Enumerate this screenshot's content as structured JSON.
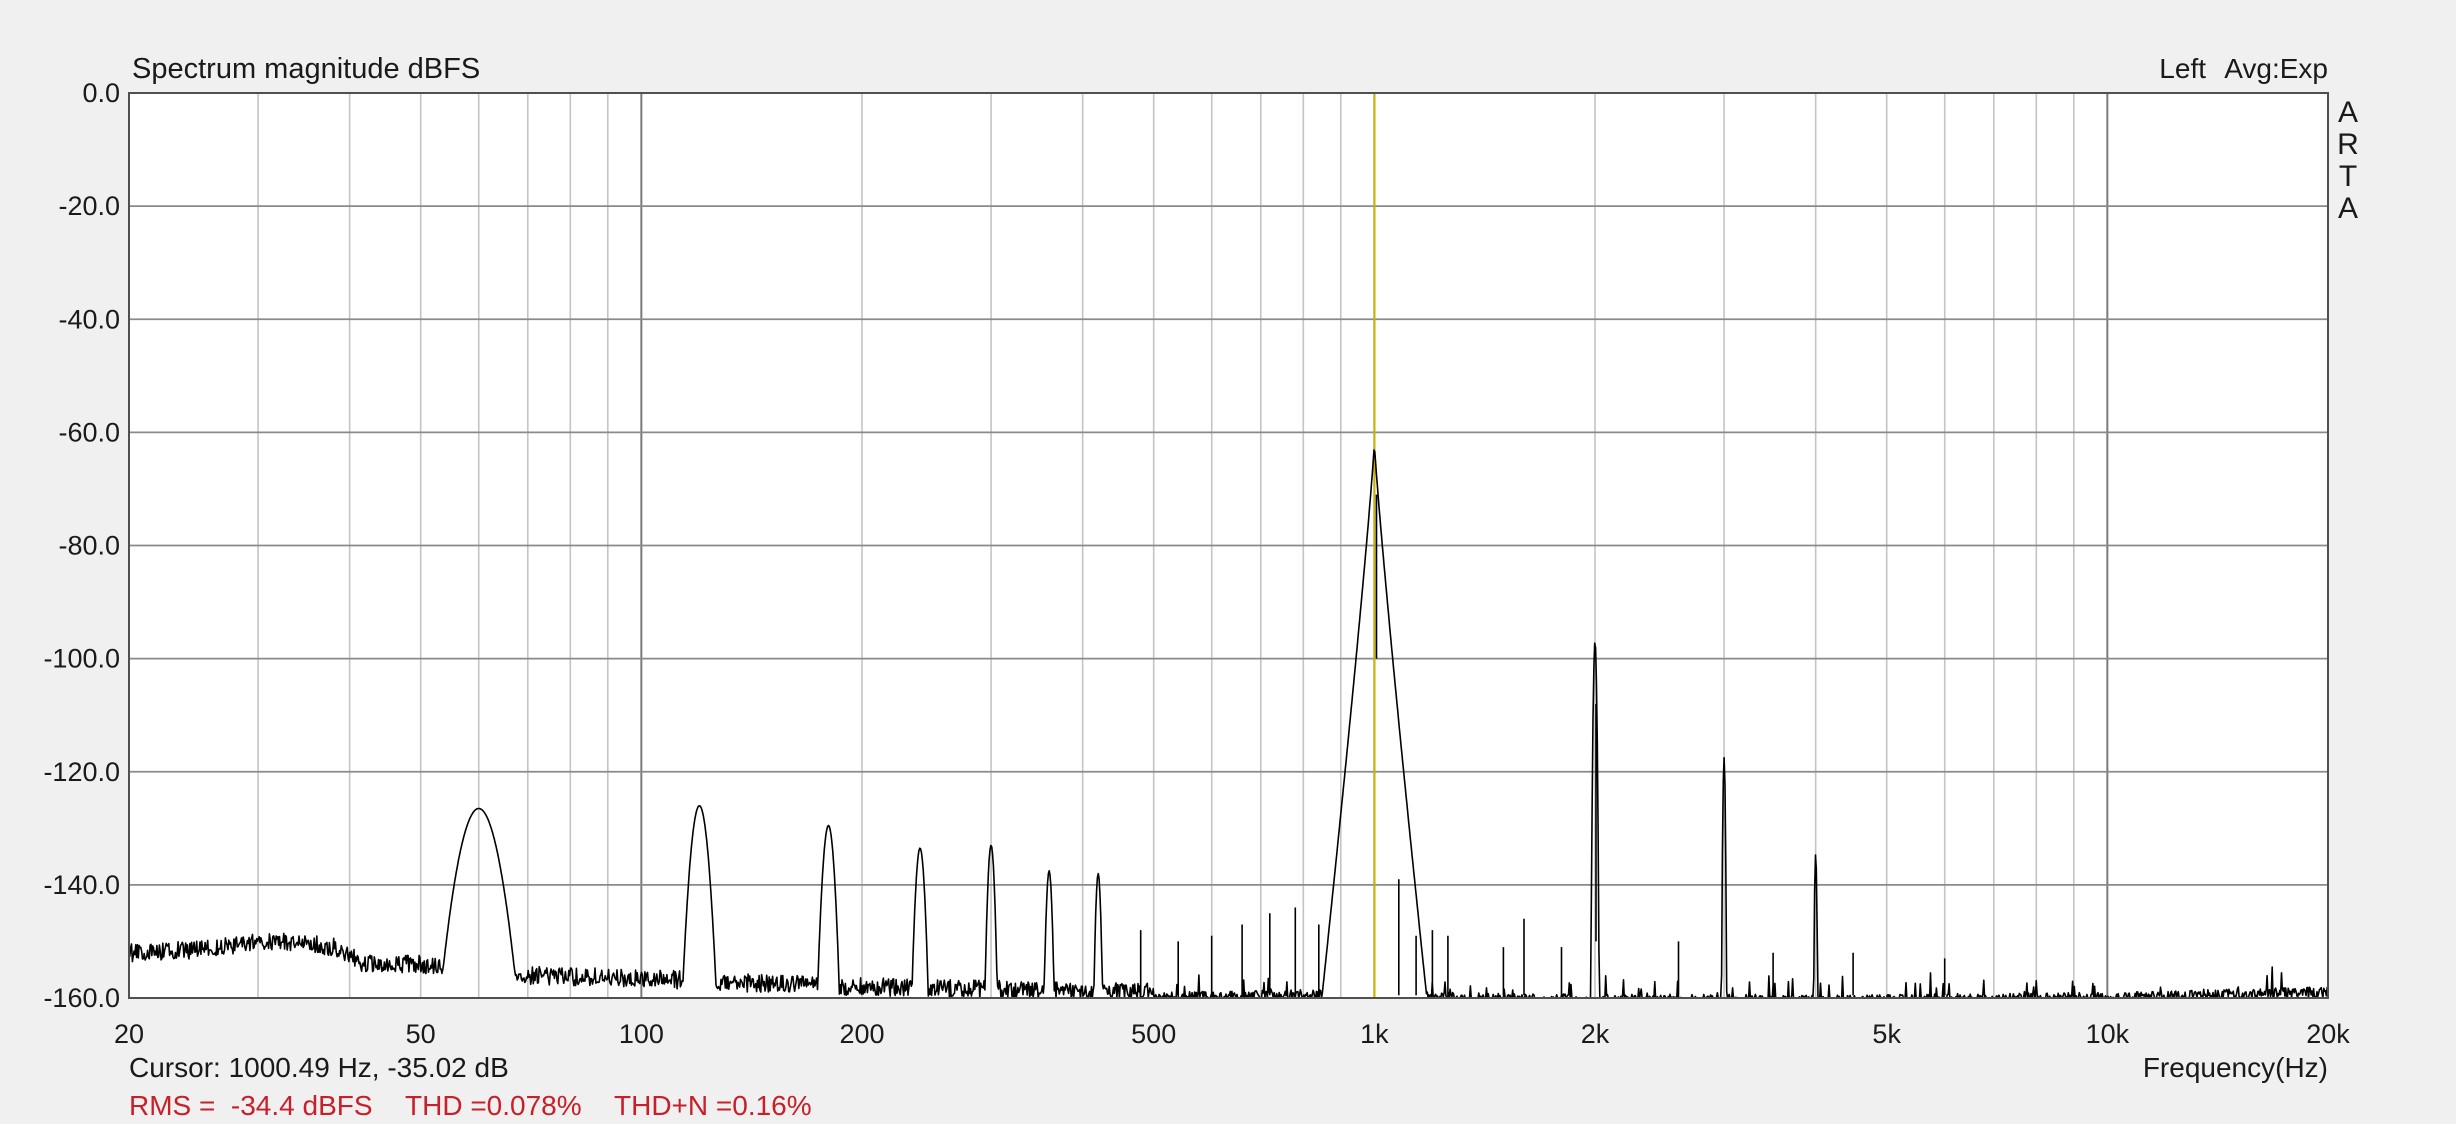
{
  "chart_data": {
    "type": "line",
    "title": "Spectrum magnitude dBFS",
    "channel": "Left",
    "averaging": "Avg:Exp",
    "brand": "ARTA",
    "xlabel": "Frequency(Hz)",
    "ylabel": "",
    "x_scale": "log",
    "xlim": [
      20,
      20000
    ],
    "ylim": [
      -160,
      0
    ],
    "grid": true,
    "x_ticks": [
      {
        "value": 20,
        "label": "20"
      },
      {
        "value": 50,
        "label": "50"
      },
      {
        "value": 100,
        "label": "100"
      },
      {
        "value": 200,
        "label": "200"
      },
      {
        "value": 500,
        "label": "500"
      },
      {
        "value": 1000,
        "label": "1k"
      },
      {
        "value": 2000,
        "label": "2k"
      },
      {
        "value": 5000,
        "label": "5k"
      },
      {
        "value": 10000,
        "label": "10k"
      },
      {
        "value": 20000,
        "label": "20k"
      }
    ],
    "y_ticks": [
      {
        "value": 0,
        "label": "0.0"
      },
      {
        "value": -20,
        "label": "-20.0"
      },
      {
        "value": -40,
        "label": "-40.0"
      },
      {
        "value": -60,
        "label": "-60.0"
      },
      {
        "value": -80,
        "label": "-80.0"
      },
      {
        "value": -100,
        "label": "-100.0"
      },
      {
        "value": -120,
        "label": "-120.0"
      },
      {
        "value": -140,
        "label": "-140.0"
      },
      {
        "value": -160,
        "label": "-160.0"
      }
    ],
    "cursor_frequency": 1000.49,
    "cursor_color": "#c8b400",
    "line_color": "#000000",
    "series": [
      {
        "noise_floor": [
          [
            20,
            -152
          ],
          [
            25,
            -151.5
          ],
          [
            30,
            -150
          ],
          [
            35,
            -150.3
          ],
          [
            38,
            -151
          ],
          [
            42,
            -154
          ],
          [
            50,
            -154
          ],
          [
            55,
            -155
          ],
          [
            70,
            -156
          ],
          [
            100,
            -156.5
          ],
          [
            150,
            -157.5
          ],
          [
            200,
            -158
          ],
          [
            300,
            -158.5
          ],
          [
            500,
            -159
          ],
          [
            800,
            -158.5
          ],
          [
            1500,
            -159.2
          ],
          [
            5000,
            -159.4
          ],
          [
            10000,
            -159
          ],
          [
            20000,
            -158
          ]
        ],
        "peaks": [
          {
            "f": 60,
            "level": -126.5,
            "width": 0.05
          },
          {
            "f": 120,
            "level": -126,
            "width": 0.022
          },
          {
            "f": 180,
            "level": -129.5,
            "width": 0.015
          },
          {
            "f": 240,
            "level": -133.5,
            "width": 0.012
          },
          {
            "f": 300,
            "level": -133,
            "width": 0.009
          },
          {
            "f": 360,
            "level": -137.5,
            "width": 0.008
          },
          {
            "f": 420,
            "level": -138,
            "width": 0.007
          },
          {
            "f": 1000,
            "level": -62,
            "width": 0.04
          },
          {
            "f": 2000,
            "level": -97,
            "width": 0.004
          },
          {
            "f": 3000,
            "level": -117.5,
            "width": 0.003
          },
          {
            "f": 4000,
            "level": -134.5,
            "width": 0.003
          }
        ],
        "spurs": [
          {
            "f": 480,
            "level": -148
          },
          {
            "f": 540,
            "level": -150
          },
          {
            "f": 600,
            "level": -149
          },
          {
            "f": 660,
            "level": -147
          },
          {
            "f": 720,
            "level": -145
          },
          {
            "f": 780,
            "level": -144
          },
          {
            "f": 840,
            "level": -147
          },
          {
            "f": 1080,
            "level": -139
          },
          {
            "f": 1140,
            "level": -149
          },
          {
            "f": 1200,
            "level": -148
          },
          {
            "f": 1260,
            "level": -149
          },
          {
            "f": 1500,
            "level": -151
          },
          {
            "f": 1600,
            "level": -146
          },
          {
            "f": 1800,
            "level": -151
          },
          {
            "f": 2600,
            "level": -150
          },
          {
            "f": 3500,
            "level": -152
          },
          {
            "f": 4500,
            "level": -152
          },
          {
            "f": 6000,
            "level": -153
          }
        ]
      }
    ]
  },
  "readouts": {
    "cursor": "Cursor: 1000.49 Hz, -35.02 dB",
    "rms": "RMS =  -34.4 dBFS",
    "thd": "THD =0.078%",
    "thdn": "THD+N =0.16%",
    "color": "#c8202a"
  }
}
